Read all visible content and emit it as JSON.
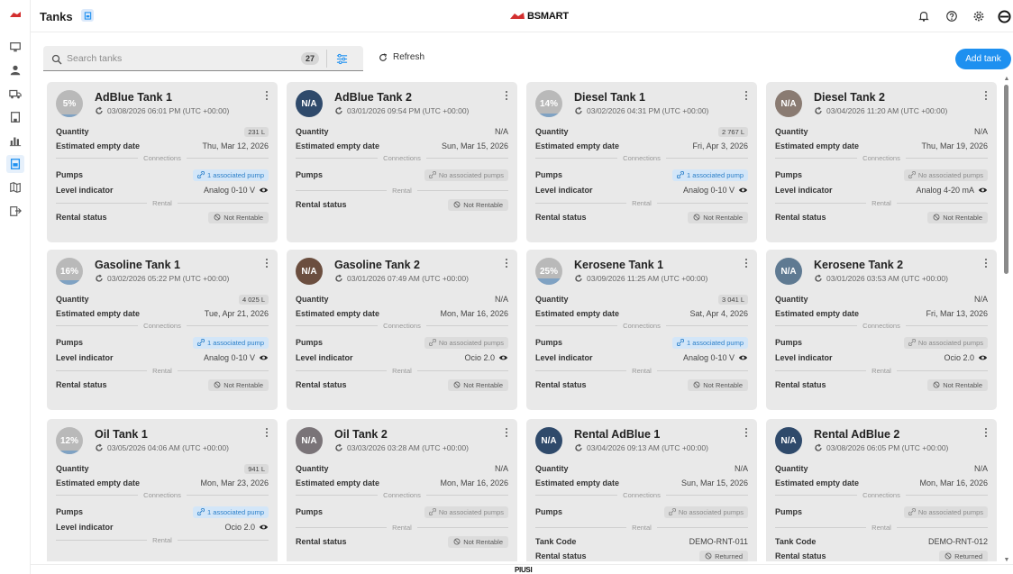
{
  "header": {
    "title": "Tanks",
    "brand": "BSMART"
  },
  "toolbar": {
    "search_placeholder": "Search tanks",
    "count": "27",
    "refresh_label": "Refresh",
    "add_label": "Add tank"
  },
  "footer": {
    "logo": "PIUSI"
  },
  "colors": {
    "accent": "#1e90f0",
    "brand_red": "#d32f2f"
  },
  "labels": {
    "quantity": "Quantity",
    "estimated_empty": "Estimated empty date",
    "connections": "Connections",
    "pumps": "Pumps",
    "level_indicator": "Level indicator",
    "rental": "Rental",
    "rental_status": "Rental status",
    "tank_code": "Tank Code"
  },
  "cards": [
    {
      "name": "AdBlue Tank 1",
      "badge": "5%",
      "level": 0.05,
      "date": "03/08/2026 06:01 PM (UTC +00:00)",
      "quantity": "231 L",
      "qty_chip": true,
      "empty_date": "Thu, Mar 12, 2026",
      "pumps": "1 associated pump",
      "pumps_on": true,
      "level_indicator": "Analog 0-10 V",
      "rental_status": "Not Rentable"
    },
    {
      "name": "AdBlue Tank 2",
      "badge": "N/A",
      "avatar_color": "#2f4a6b",
      "date": "03/01/2026 09:54 PM (UTC +00:00)",
      "quantity": "N/A",
      "qty_chip": false,
      "empty_date": "Sun, Mar 15, 2026",
      "pumps": "No associated pumps",
      "pumps_on": false,
      "level_indicator": "",
      "rental_status": "Not Rentable"
    },
    {
      "name": "Diesel Tank 1",
      "badge": "14%",
      "level": 0.14,
      "date": "03/02/2026 04:31 PM (UTC +00:00)",
      "quantity": "2 767 L",
      "qty_chip": true,
      "empty_date": "Fri, Apr 3, 2026",
      "pumps": "1 associated pump",
      "pumps_on": true,
      "level_indicator": "Analog 0-10 V",
      "rental_status": "Not Rentable"
    },
    {
      "name": "Diesel Tank 2",
      "badge": "N/A",
      "avatar_color": "#8a7b72",
      "date": "03/04/2026 11:20 AM (UTC +00:00)",
      "quantity": "N/A",
      "qty_chip": false,
      "empty_date": "Thu, Mar 19, 2026",
      "pumps": "No associated pumps",
      "pumps_on": false,
      "level_indicator": "Analog 4-20 mA",
      "rental_status": "Not Rentable"
    },
    {
      "name": "Gasoline Tank 1",
      "badge": "16%",
      "level": 0.16,
      "date": "03/02/2026 05:22 PM (UTC +00:00)",
      "quantity": "4 025 L",
      "qty_chip": true,
      "empty_date": "Tue, Apr 21, 2026",
      "pumps": "1 associated pump",
      "pumps_on": true,
      "level_indicator": "Analog 0-10 V",
      "rental_status": "Not Rentable"
    },
    {
      "name": "Gasoline Tank 2",
      "badge": "N/A",
      "avatar_color": "#6b4e3f",
      "date": "03/01/2026 07:49 AM (UTC +00:00)",
      "quantity": "N/A",
      "qty_chip": false,
      "empty_date": "Mon, Mar 16, 2026",
      "pumps": "No associated pumps",
      "pumps_on": false,
      "level_indicator": "Ocio 2.0",
      "rental_status": "Not Rentable"
    },
    {
      "name": "Kerosene Tank 1",
      "badge": "25%",
      "level": 0.25,
      "date": "03/09/2026 11:25 AM (UTC +00:00)",
      "quantity": "3 041 L",
      "qty_chip": true,
      "empty_date": "Sat, Apr 4, 2026",
      "pumps": "1 associated pump",
      "pumps_on": true,
      "level_indicator": "Analog 0-10 V",
      "rental_status": "Not Rentable"
    },
    {
      "name": "Kerosene Tank 2",
      "badge": "N/A",
      "avatar_color": "#5f7a92",
      "date": "03/01/2026 03:53 AM (UTC +00:00)",
      "quantity": "N/A",
      "qty_chip": false,
      "empty_date": "Fri, Mar 13, 2026",
      "pumps": "No associated pumps",
      "pumps_on": false,
      "level_indicator": "Ocio 2.0",
      "rental_status": "Not Rentable"
    },
    {
      "name": "Oil Tank 1",
      "badge": "12%",
      "level": 0.12,
      "date": "03/05/2026 04:06 AM (UTC +00:00)",
      "quantity": "941 L",
      "qty_chip": true,
      "empty_date": "Mon, Mar 23, 2026",
      "pumps": "1 associated pump",
      "pumps_on": true,
      "level_indicator": "Ocio 2.0",
      "rental_status": ""
    },
    {
      "name": "Oil Tank 2",
      "badge": "N/A",
      "avatar_color": "#7a7478",
      "date": "03/03/2026 03:28 AM (UTC +00:00)",
      "quantity": "N/A",
      "qty_chip": false,
      "empty_date": "Mon, Mar 16, 2026",
      "pumps": "No associated pumps",
      "pumps_on": false,
      "level_indicator": "",
      "rental_status": "Not Rentable"
    },
    {
      "name": "Rental AdBlue 1",
      "badge": "N/A",
      "avatar_color": "#2f4a6b",
      "date": "03/04/2026 09:13 AM (UTC +00:00)",
      "quantity": "N/A",
      "qty_chip": false,
      "empty_date": "Sun, Mar 15, 2026",
      "pumps": "No associated pumps",
      "pumps_on": false,
      "level_indicator": "",
      "tank_code": "DEMO-RNT-011",
      "rental_status": "Returned"
    },
    {
      "name": "Rental AdBlue 2",
      "badge": "N/A",
      "avatar_color": "#2f4a6b",
      "date": "03/08/2026 06:05 PM (UTC +00:00)",
      "quantity": "N/A",
      "qty_chip": false,
      "empty_date": "Mon, Mar 16, 2026",
      "pumps": "No associated pumps",
      "pumps_on": false,
      "level_indicator": "",
      "tank_code": "DEMO-RNT-012",
      "rental_status": "Returned"
    }
  ]
}
